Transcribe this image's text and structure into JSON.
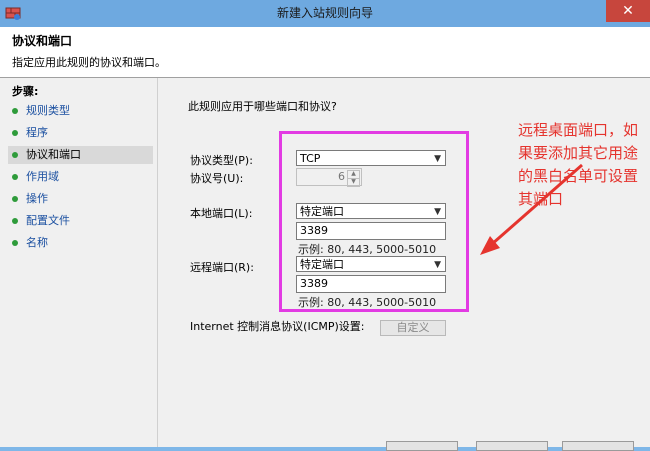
{
  "window": {
    "title": "新建入站规则向导",
    "close_glyph": "✕"
  },
  "header": {
    "title": "协议和端口",
    "description": "指定应用此规则的协议和端口。"
  },
  "steps": {
    "title": "步骤:",
    "items": [
      {
        "label": "规则类型"
      },
      {
        "label": "程序"
      },
      {
        "label": "协议和端口"
      },
      {
        "label": "作用域"
      },
      {
        "label": "操作"
      },
      {
        "label": "配置文件"
      },
      {
        "label": "名称"
      }
    ]
  },
  "form": {
    "question": "此规则应用于哪些端口和协议?",
    "protocol_type_label": "协议类型(P):",
    "protocol_type_value": "TCP",
    "protocol_number_label": "协议号(U):",
    "protocol_number_value": "6",
    "local_port_label": "本地端口(L):",
    "local_port_select": "特定端口",
    "local_port_value": "3389",
    "local_port_example": "示例: 80, 443, 5000-5010",
    "remote_port_label": "远程端口(R):",
    "remote_port_select": "特定端口",
    "remote_port_value": "3389",
    "remote_port_example": "示例: 80, 443, 5000-5010",
    "icmp_label": "Internet 控制消息协议(ICMP)设置:",
    "customize_button": "自定义"
  },
  "annotation": {
    "text": "远程桌面端口，如果要添加其它用途的黑白名单可设置其端口",
    "color": "#e5342e"
  },
  "colors": {
    "titlebar": "#6ea9e0",
    "highlight_box": "#e23be3",
    "step_dot": "#2e9b3a",
    "close_button": "#c7463d"
  }
}
